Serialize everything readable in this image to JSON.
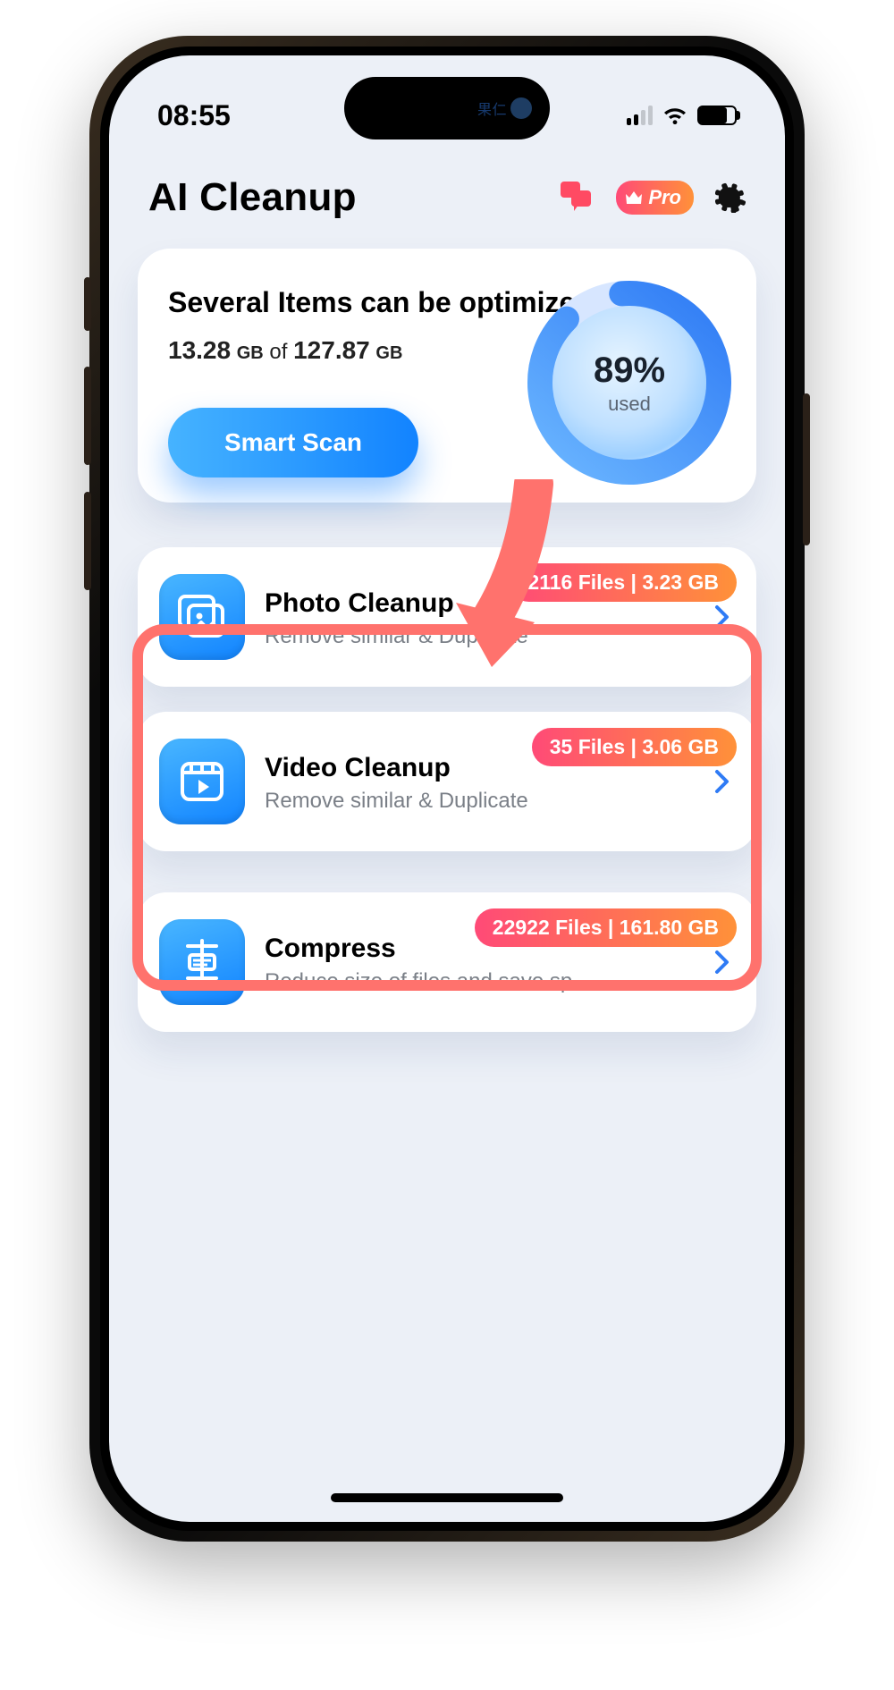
{
  "statusbar": {
    "time": "08:55"
  },
  "header": {
    "title": "AI Cleanup",
    "pro_label": "Pro"
  },
  "island": {
    "label": "果仁"
  },
  "summary": {
    "title": "Several Items can be optimized",
    "used_value": "13.28",
    "used_unit": "GB",
    "of_word": "of",
    "total_value": "127.87",
    "total_unit": "GB",
    "scan_label": "Smart Scan"
  },
  "ring": {
    "percent_label": "89%",
    "used_label": "used",
    "percent": 89
  },
  "features": [
    {
      "id": "photo",
      "title": "Photo Cleanup",
      "desc": "Remove similar & Duplicate",
      "badge": "2116 Files | 3.23 GB"
    },
    {
      "id": "video",
      "title": "Video Cleanup",
      "desc": "Remove similar & Duplicate",
      "badge": "35 Files | 3.06 GB"
    },
    {
      "id": "compress",
      "title": "Compress",
      "desc": "Reduce size of files and save sp...",
      "badge": "22922 Files | 161.80 GB"
    }
  ]
}
